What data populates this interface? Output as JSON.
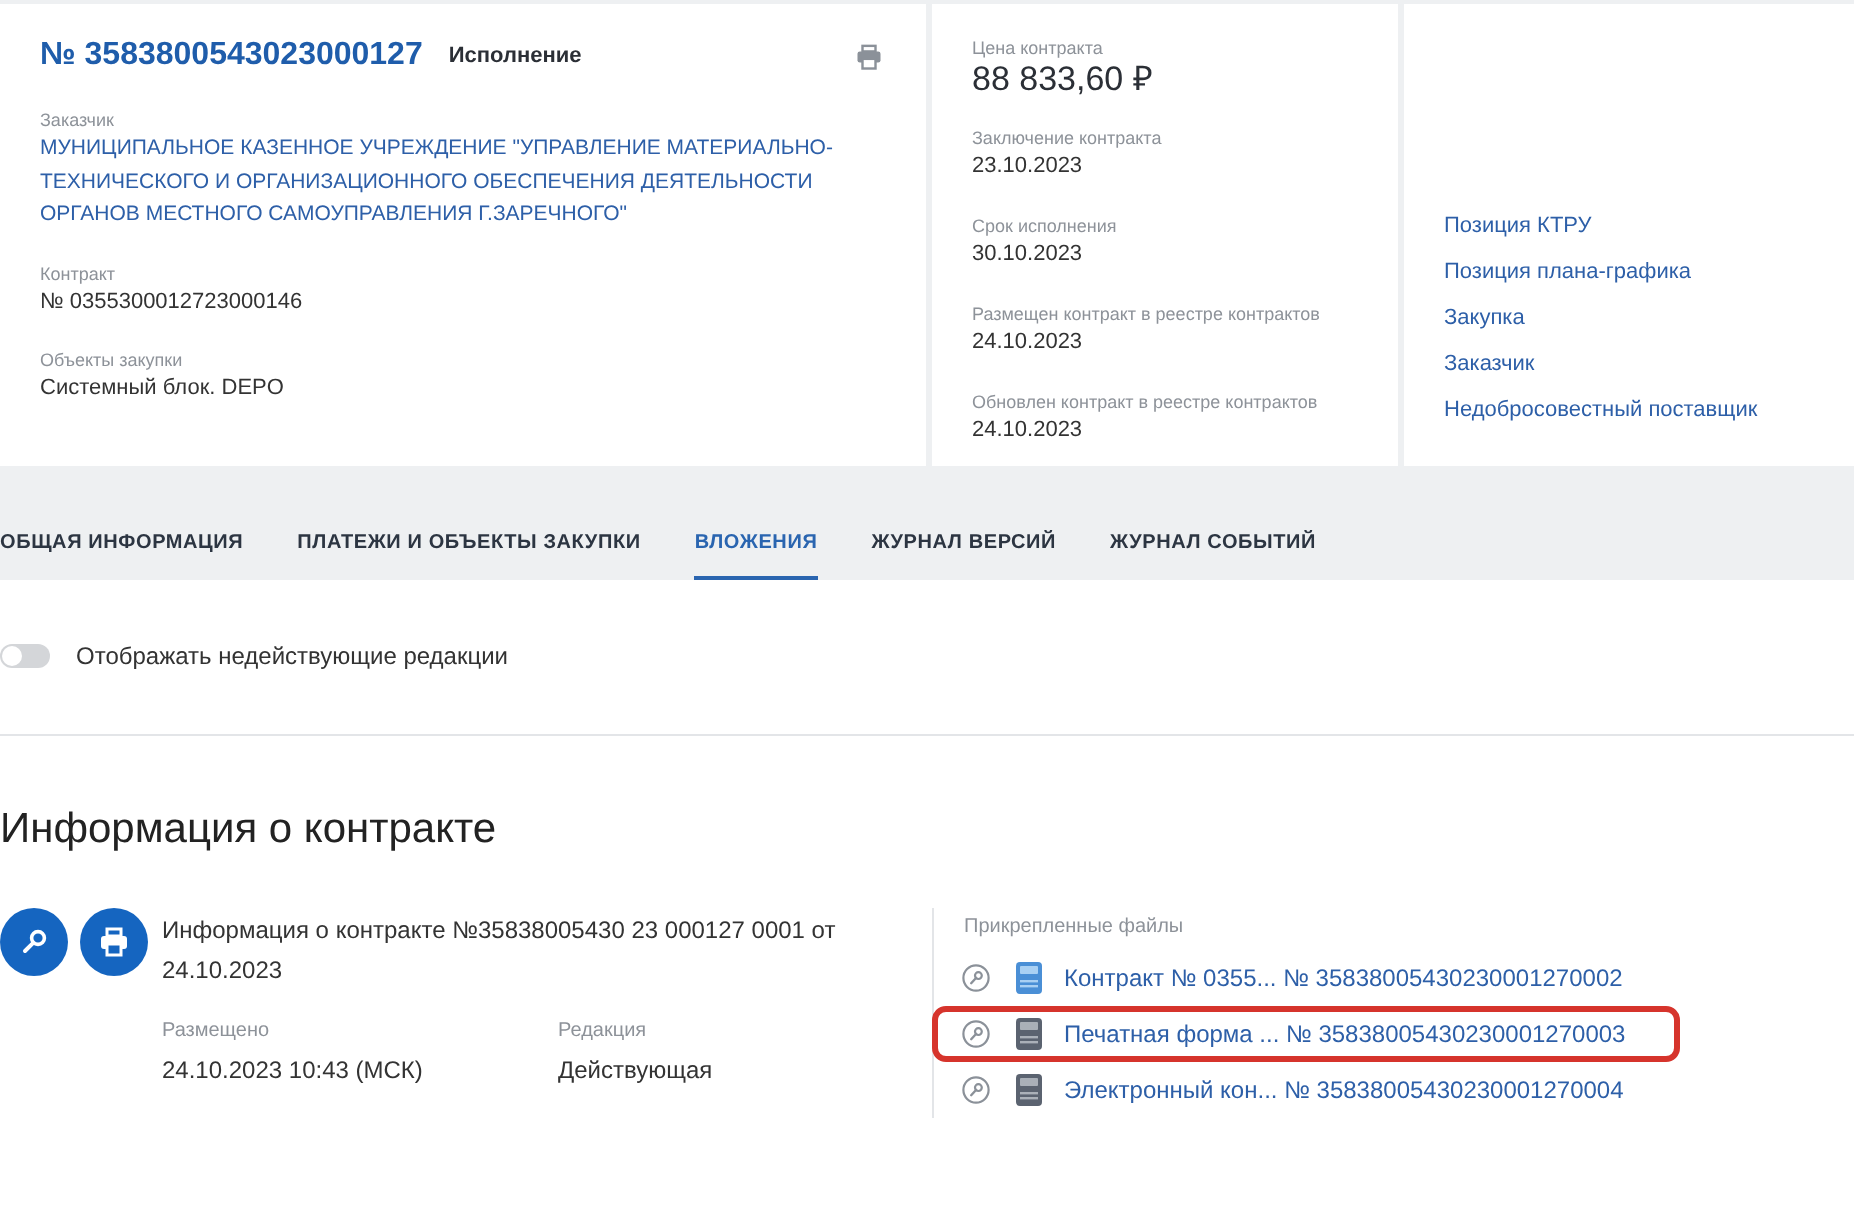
{
  "contract": {
    "title": "№ 3583800543023000127",
    "status": "Исполнение",
    "fields": [
      {
        "label": "Заказчик",
        "value": "МУНИЦИПАЛЬНОЕ КАЗЕННОЕ УЧРЕЖДЕНИЕ \"УПРАВЛЕНИЕ МАТЕРИАЛЬНО-ТЕХНИЧЕСКОГО И ОРГАНИЗАЦИОННОГО ОБЕСПЕЧЕНИЯ ДЕЯТЕЛЬНОСТИ ОРГАНОВ МЕСТНОГО САМОУПРАВЛЕНИЯ Г.ЗАРЕЧНОГО\"",
        "kind": "link"
      },
      {
        "label": "Контракт",
        "value": "№ 0355300012723000146",
        "kind": "text"
      },
      {
        "label": "Объекты закупки",
        "value": "Системный блок. DEPO",
        "kind": "text"
      }
    ]
  },
  "summary": {
    "price_label": "Цена контракта",
    "price": "88 833,60 ₽",
    "fields": [
      {
        "label": "Заключение контракта",
        "value": "23.10.2023"
      },
      {
        "label": "Срок исполнения",
        "value": "30.10.2023"
      },
      {
        "label": "Размещен контракт в реестре контрактов",
        "value": "24.10.2023"
      },
      {
        "label": "Обновлен контракт в реестре контрактов",
        "value": "24.10.2023"
      }
    ]
  },
  "links": [
    "Позиция КТРУ",
    "Позиция плана-графика",
    "Закупка",
    "Заказчик",
    "Недобросовестный поставщик"
  ],
  "tabs": [
    {
      "label": "ОБЩАЯ ИНФОРМАЦИЯ",
      "selected": false
    },
    {
      "label": "ПЛАТЕЖИ И ОБЪЕКТЫ ЗАКУПКИ",
      "selected": false
    },
    {
      "label": "ВЛОЖЕНИЯ",
      "selected": true
    },
    {
      "label": "ЖУРНАЛ ВЕРСИЙ",
      "selected": false
    },
    {
      "label": "ЖУРНАЛ СОБЫТИЙ",
      "selected": false
    }
  ],
  "toggle": {
    "label": "Отображать недействующие редакции",
    "on": false
  },
  "section": {
    "title": "Информация о контракте",
    "entry": {
      "title": "Информация о контракте №35838005430 23 000127 0001 от 24.10.2023",
      "meta": [
        {
          "label": "Размещено",
          "value": "24.10.2023 10:43 (МСК)"
        },
        {
          "label": "Редакция",
          "value": "Действующая"
        }
      ]
    },
    "files": {
      "label": "Прикрепленные файлы",
      "items": [
        {
          "name": "Контракт № 0355... № 35838005430230001270002",
          "kind": "document",
          "highlighted": false
        },
        {
          "name": "Печатная форма ... № 35838005430230001270003",
          "kind": "form",
          "highlighted": true
        },
        {
          "name": "Электронный кон... № 35838005430230001270004",
          "kind": "form",
          "highlighted": false
        }
      ]
    }
  }
}
